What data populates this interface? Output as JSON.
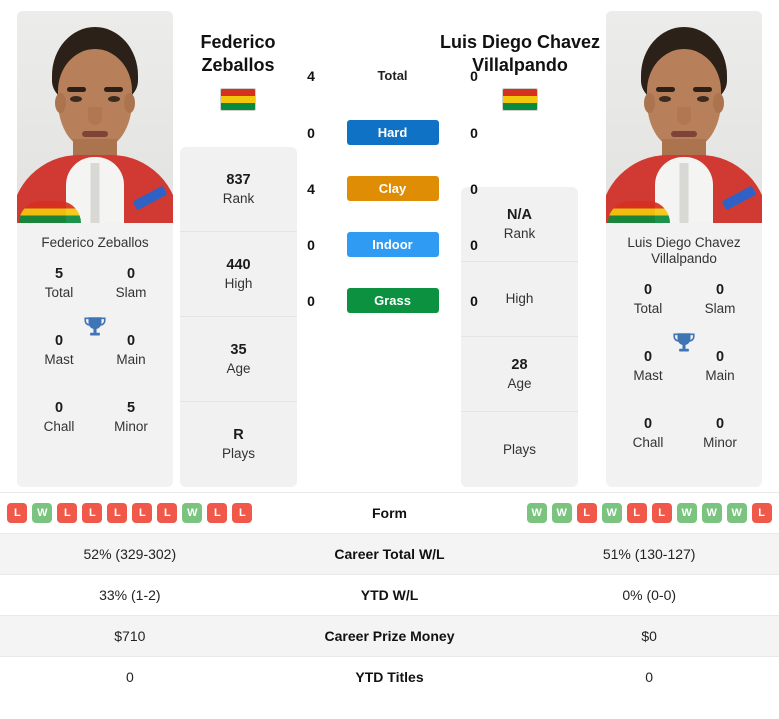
{
  "players": {
    "left": {
      "display_name_line1": "Federico",
      "display_name_line2": "Zeballos",
      "card_name": "Federico Zeballos",
      "country_flag": "bolivia-flag",
      "titles": {
        "total_value": "5",
        "total_label": "Total",
        "slam_value": "0",
        "slam_label": "Slam",
        "mast_value": "0",
        "mast_label": "Mast",
        "main_value": "0",
        "main_label": "Main",
        "chall_value": "0",
        "chall_label": "Chall",
        "minor_value": "5",
        "minor_label": "Minor"
      },
      "ranking": {
        "rank_value": "837",
        "rank_label": "Rank",
        "high_value": "440",
        "high_label": "High",
        "age_value": "35",
        "age_label": "Age",
        "plays_value": "R",
        "plays_label": "Plays"
      },
      "form": [
        "L",
        "W",
        "L",
        "L",
        "L",
        "L",
        "L",
        "W",
        "L",
        "L"
      ],
      "career_total_wl": "52% (329-302)",
      "ytd_wl": "33% (1-2)",
      "career_prize_money": "$710",
      "ytd_titles": "0"
    },
    "right": {
      "display_name_line1": "Luis Diego Chavez",
      "display_name_line2": "Villalpando",
      "card_name_line1": "Luis Diego Chavez",
      "card_name_line2": "Villalpando",
      "country_flag": "bolivia-flag",
      "titles": {
        "total_value": "0",
        "total_label": "Total",
        "slam_value": "0",
        "slam_label": "Slam",
        "mast_value": "0",
        "mast_label": "Mast",
        "main_value": "0",
        "main_label": "Main",
        "chall_value": "0",
        "chall_label": "Chall",
        "minor_value": "0",
        "minor_label": "Minor"
      },
      "ranking": {
        "rank_value": "N/A",
        "rank_label": "Rank",
        "high_value": "",
        "high_label": "High",
        "age_value": "28",
        "age_label": "Age",
        "plays_value": "",
        "plays_label": "Plays"
      },
      "form": [
        "W",
        "W",
        "L",
        "W",
        "L",
        "L",
        "W",
        "W",
        "W",
        "L"
      ],
      "career_total_wl": "51% (130-127)",
      "ytd_wl": "0% (0-0)",
      "career_prize_money": "$0",
      "ytd_titles": "0"
    }
  },
  "surfaces": [
    {
      "key": "total",
      "label": "Total",
      "left_value": "4",
      "right_value": "0",
      "color": "transparent"
    },
    {
      "key": "hard",
      "label": "Hard",
      "left_value": "0",
      "right_value": "0",
      "color": "#0f72c4"
    },
    {
      "key": "clay",
      "label": "Clay",
      "left_value": "4",
      "right_value": "0",
      "color": "#e08d06"
    },
    {
      "key": "indoor",
      "label": "Indoor",
      "left_value": "0",
      "right_value": "0",
      "color": "#2f9bf2"
    },
    {
      "key": "grass",
      "label": "Grass",
      "left_value": "0",
      "right_value": "0",
      "color": "#0b9140"
    }
  ],
  "comparison_rows": [
    {
      "label": "Form"
    },
    {
      "label": "Career Total W/L"
    },
    {
      "label": "YTD W/L"
    },
    {
      "label": "Career Prize Money"
    },
    {
      "label": "YTD Titles"
    }
  ],
  "colors": {
    "win_badge": "#7bc47f",
    "loss_badge": "#f0594a",
    "trophy": "#3f74b5",
    "panel_bg": "#f1f1f1",
    "row_shade": "#f4f4f4"
  }
}
